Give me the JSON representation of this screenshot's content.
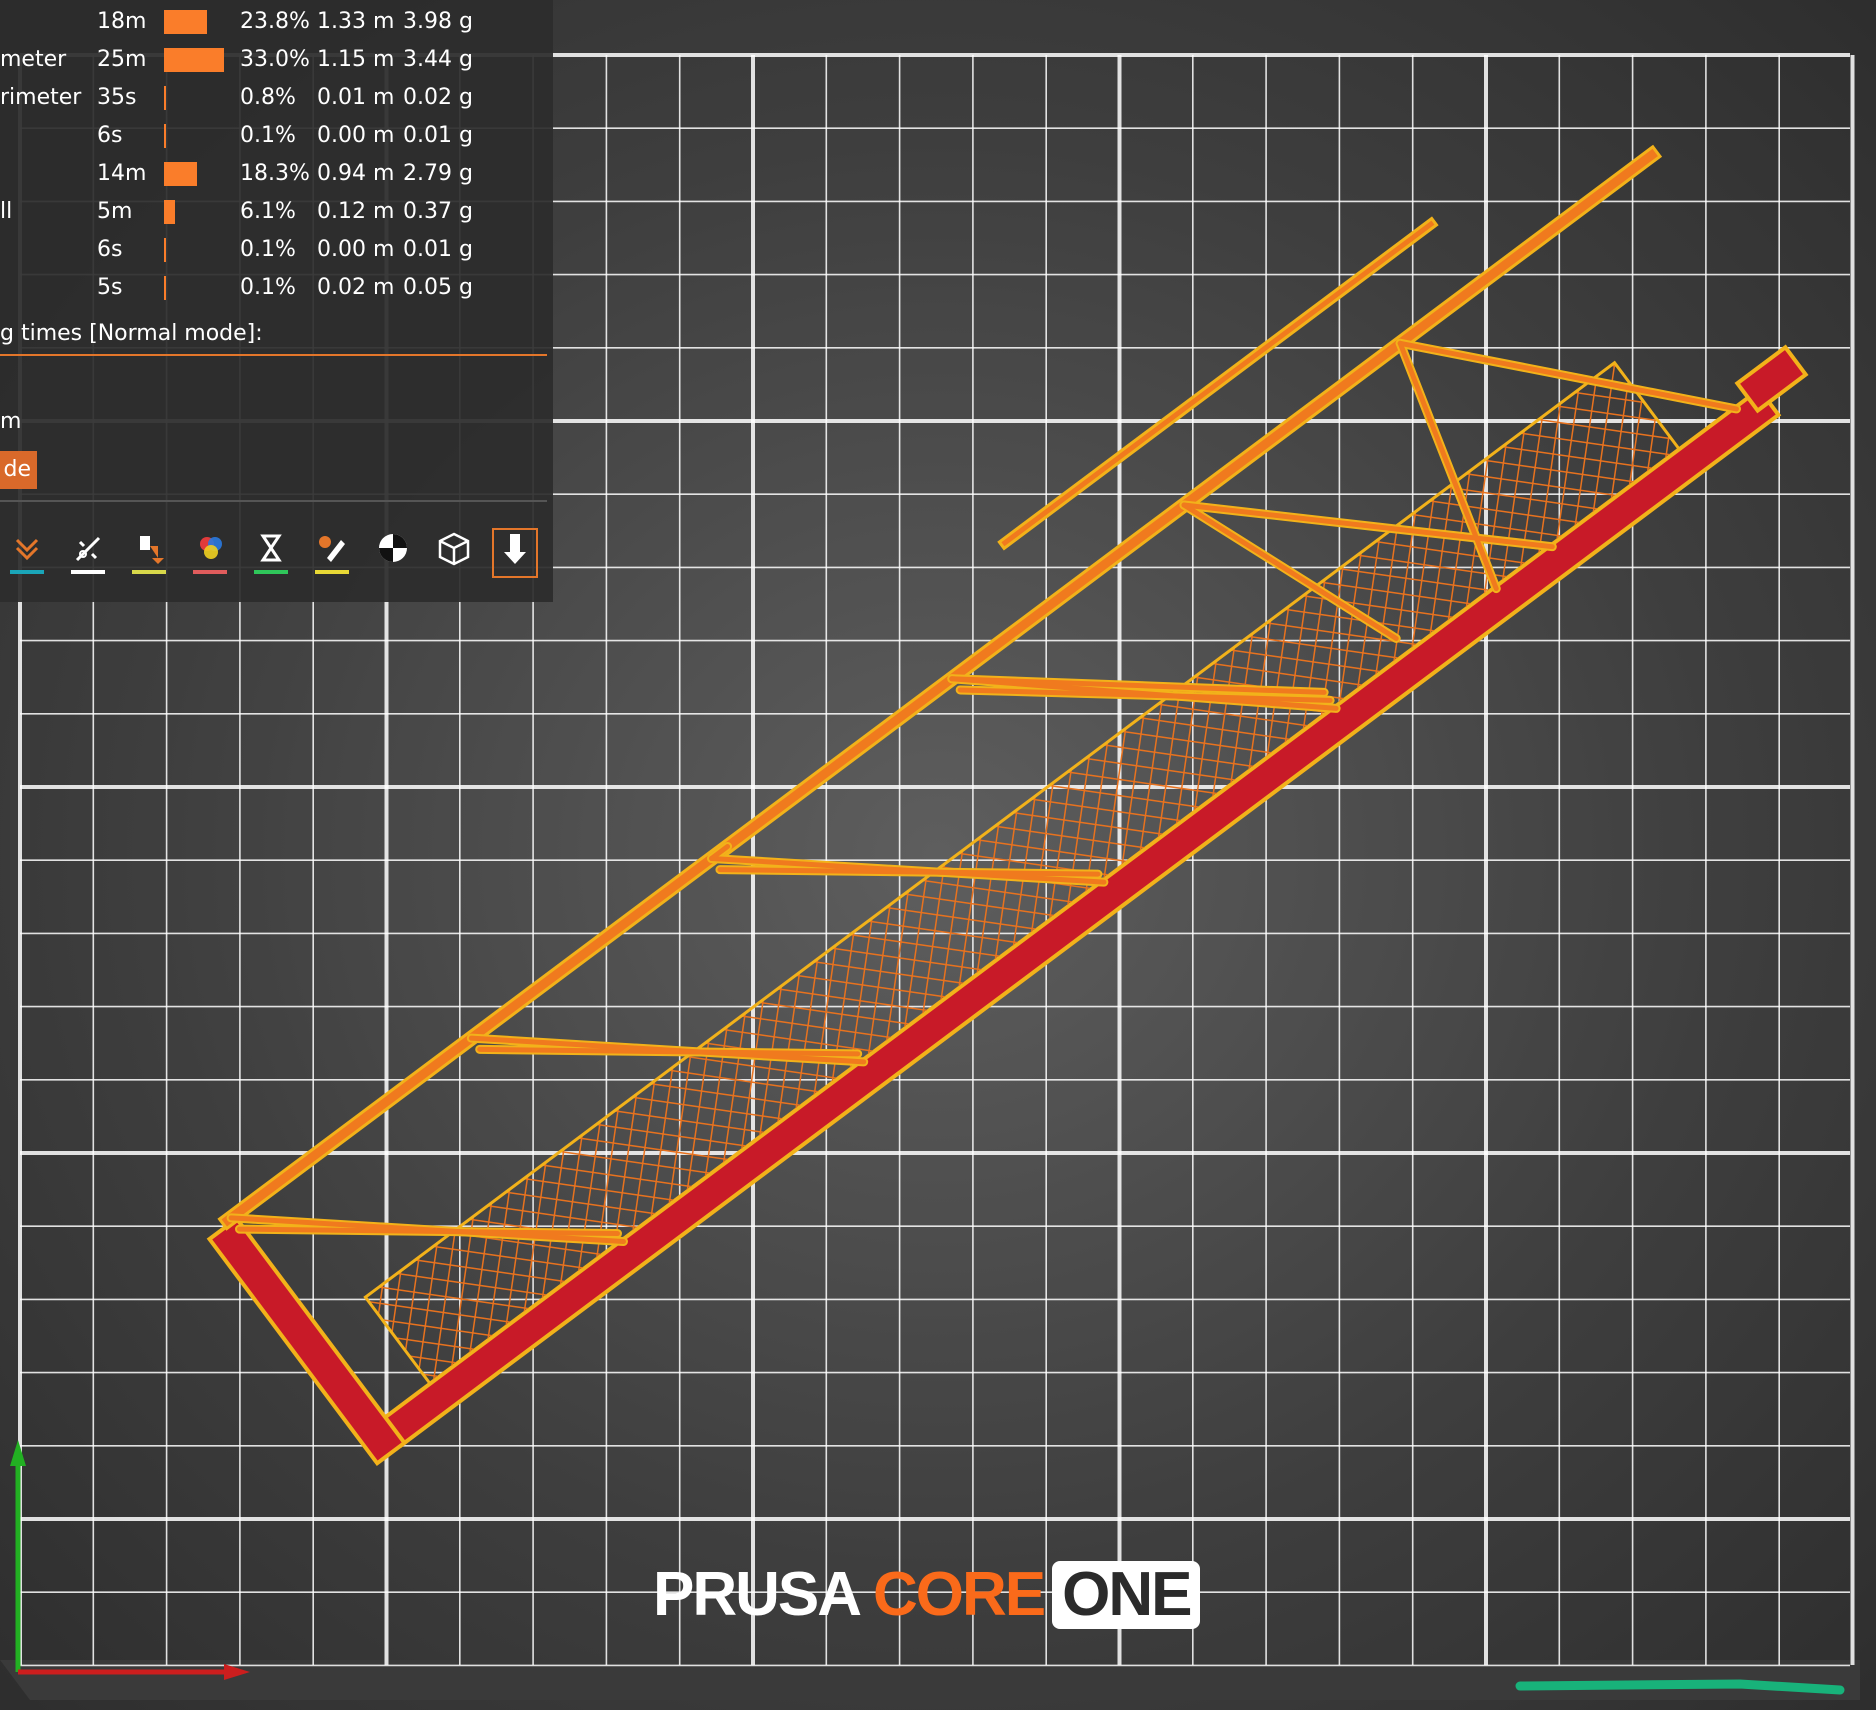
{
  "stats_panel": {
    "rows": [
      {
        "label": "",
        "time": "18m",
        "percent": "23.8%",
        "length": "1.33 m",
        "weight": "3.98 g",
        "share": 0.238
      },
      {
        "label": "meter",
        "time": "25m",
        "percent": "33.0%",
        "length": "1.15 m",
        "weight": "3.44 g",
        "share": 0.33
      },
      {
        "label": "rimeter",
        "time": "35s",
        "percent": "0.8%",
        "length": "0.01 m",
        "weight": "0.02 g",
        "share": 0.008
      },
      {
        "label": "",
        "time": "6s",
        "percent": "0.1%",
        "length": "0.00 m",
        "weight": "0.01 g",
        "share": 0.001
      },
      {
        "label": "",
        "time": "14m",
        "percent": "18.3%",
        "length": "0.94 m",
        "weight": "2.79 g",
        "share": 0.183
      },
      {
        "label": "ll",
        "time": "5m",
        "percent": "6.1%",
        "length": "0.12 m",
        "weight": "0.37 g",
        "share": 0.061
      },
      {
        "label": "",
        "time": "6s",
        "percent": "0.1%",
        "length": "0.00 m",
        "weight": "0.01 g",
        "share": 0.001
      },
      {
        "label": "",
        "time": "5s",
        "percent": "0.1%",
        "length": "0.02 m",
        "weight": "0.05 g",
        "share": 0.001
      }
    ],
    "estimated_times_label": "g times [Normal mode]:",
    "time_fragment": "m",
    "mode_button_label": "de"
  },
  "toolbar": {
    "buttons": [
      {
        "name": "travel-view-icon",
        "underline": "#1aa5b8"
      },
      {
        "name": "wipe-view-icon",
        "underline": "#ffffff"
      },
      {
        "name": "retractions-view-icon",
        "underline": "#d8d84a"
      },
      {
        "name": "color-changes-view-icon",
        "underline": "#e05c5c"
      },
      {
        "name": "pause-prints-view-icon",
        "underline": "#2fc65a"
      },
      {
        "name": "custom-gcode-view-icon",
        "underline": "#e8d835"
      },
      {
        "name": "center-of-gravity-icon",
        "underline": ""
      },
      {
        "name": "shells-view-icon",
        "underline": ""
      },
      {
        "name": "tool-marker-icon",
        "underline": "",
        "active": true
      }
    ]
  },
  "bed_logo": {
    "brand": "PRUSA",
    "line": "CORE",
    "model": "ONE"
  },
  "colors": {
    "extrusion_orange": "#f07a1e",
    "outline_yellow": "#f2b21a",
    "solid_infill_red": "#c81a28",
    "bed_background": "#3a3a3a",
    "grid_line": "#ffffff",
    "accent": "#e4762a"
  }
}
